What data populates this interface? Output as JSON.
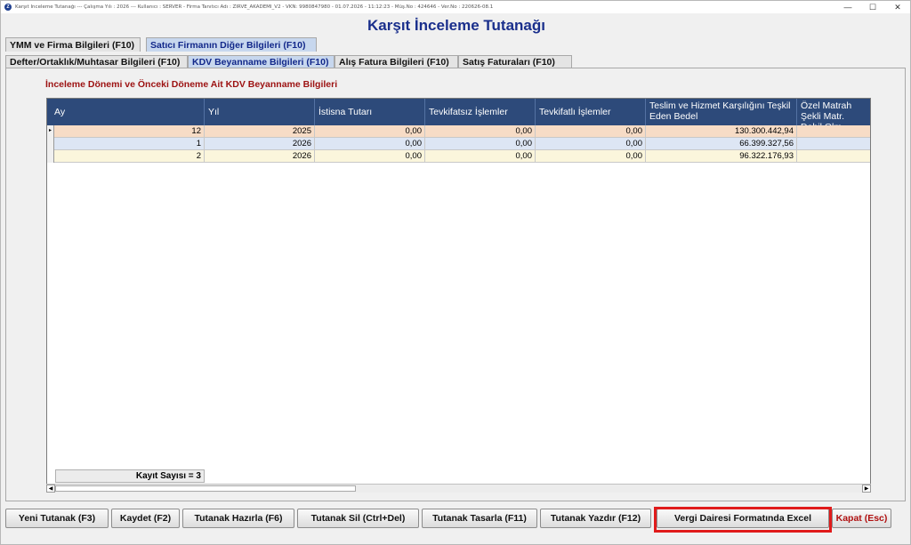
{
  "titlebar": {
    "info": "Karşıt İnceleme Tutanağı  ---  Çalışma Yılı : 2026  ---  Kullanıcı : SERVER - Firma Tanıtıcı Adı : ZIRVE_AKADEMI_V2 - VKN: 9980847980 - 01.07.2026 - 11:12:23 - Müş.No : 424646 - Ver.No : 220626-08.1",
    "minimize": "—",
    "maximize": "☐",
    "close": "✕"
  },
  "page_title": "Karşıt İnceleme Tutanağı",
  "tabs_row1": [
    {
      "label": "YMM ve Firma Bilgileri (F10)",
      "active": false
    },
    {
      "label": "Satıcı Firmanın Diğer Bilgileri (F10)",
      "active": true
    }
  ],
  "tabs_row2": [
    {
      "label": "Defter/Ortaklık/Muhtasar Bilgileri (F10)",
      "active": false
    },
    {
      "label": "KDV Beyanname Bilgileri (F10)",
      "active": true
    },
    {
      "label": "Alış Fatura Bilgileri (F10)",
      "active": false
    },
    {
      "label": "Satış Faturaları (F10)",
      "active": false
    }
  ],
  "section_title": "İnceleme Dönemi ve Önceki Döneme Ait KDV Beyanname Bilgileri",
  "grid": {
    "columns": [
      "Ay",
      "Yıl",
      "İstisna Tutarı",
      "Tevkifatsız İşlemler",
      "Tevkifatlı İşlemler",
      "Teslim ve Hizmet Karşılığını Teşkil Eden Bedel",
      "Özel Matrah Şekli Matr. Dahil Olm."
    ],
    "rows": [
      {
        "ay": "12",
        "yil": "2025",
        "istisna": "0,00",
        "tevkifatsiz": "0,00",
        "tevkifatli": "0,00",
        "bedel": "130.300.442,94",
        "ozel": ""
      },
      {
        "ay": "1",
        "yil": "2026",
        "istisna": "0,00",
        "tevkifatsiz": "0,00",
        "tevkifatli": "0,00",
        "bedel": "66.399.327,56",
        "ozel": ""
      },
      {
        "ay": "2",
        "yil": "2026",
        "istisna": "0,00",
        "tevkifatsiz": "0,00",
        "tevkifatli": "0,00",
        "bedel": "96.322.176,93",
        "ozel": ""
      }
    ],
    "record_count": "Kayıt Sayısı = 3",
    "row_colors": [
      "#f7dcc6",
      "#dde6f4",
      "#fbf6dc"
    ]
  },
  "buttons": {
    "new": "Yeni Tutanak (F3)",
    "save": "Kaydet (F2)",
    "prepare": "Tutanak Hazırla (F6)",
    "delete": "Tutanak Sil (Ctrl+Del)",
    "design": "Tutanak Tasarla (F11)",
    "print": "Tutanak Yazdır (F12)",
    "excel": "Vergi Dairesi Formatında Excel",
    "close": "Kapat (Esc)"
  }
}
